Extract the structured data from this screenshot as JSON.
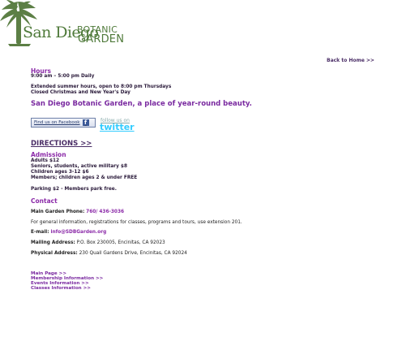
{
  "logo": {
    "san_diego": "San Diego",
    "botanic": "BOTANIC",
    "garden": "GARDEN"
  },
  "nav": {
    "back_home": "Back to Home >>"
  },
  "hours": {
    "title": "Hours",
    "daily": "9:00 am – 5:00 pm Daily",
    "extended": "Extended summer hours, open to 8:00 pm Thursdays",
    "closed": "Closed Christmas and New Year's Day"
  },
  "tagline": "San Diego Botanic Garden, a place of year-round beauty.",
  "social": {
    "facebook": "Find us on Facebook",
    "facebook_icon": "f",
    "twitter_follow": "follow us on",
    "twitter_word": "twitter"
  },
  "directions": "DIRECTIONS >>",
  "admission": {
    "title": "Admission",
    "lines": [
      "Adults $12",
      "Seniors, students, active military $8",
      "Children ages 3-12 $6",
      "Members; children ages 2 & under FREE"
    ],
    "parking": "Parking $2 - Members park free."
  },
  "contact": {
    "title": "Contact",
    "phone_label": "Main Garden Phone:",
    "phone": "760/ 436-3036",
    "info": "For general information, registrations for classes, programs and tours, use extension 201.",
    "email_label": "E-mail:",
    "email": "info@SDBGarden.org",
    "mailing_label": "Mailing Address:",
    "mailing": "P.O. Box 230005, Encinitas, CA 92023",
    "physical_label": "Physical Address:",
    "physical": "230 Quail Gardens Drive, Encinitas, CA 92024"
  },
  "footer_links": [
    "Main Page >>",
    "Membership Information >>",
    "Events Information >>",
    "Classes Information >>"
  ],
  "colors": {
    "purple": "#8b2aa8",
    "logo_green": "#4f7a3a",
    "twitter_blue": "#33ccff"
  }
}
